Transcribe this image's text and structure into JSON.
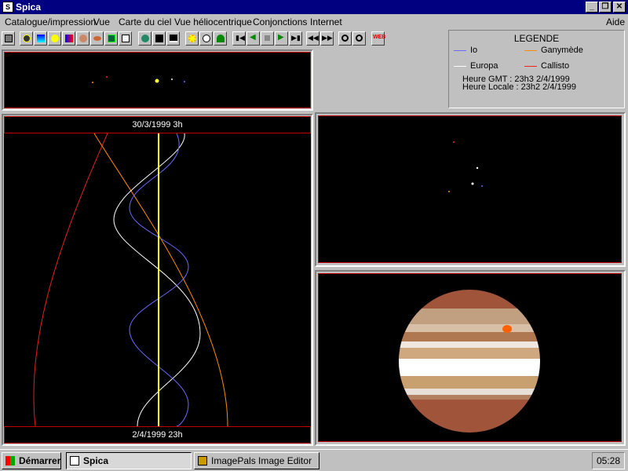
{
  "window": {
    "title": "Spica",
    "app_icon": "spica-icon"
  },
  "menu": {
    "items": [
      "Catalogue/impression",
      "Vue",
      "Carte du ciel",
      "Vue héliocentrique",
      "Conjonctions",
      "Internet"
    ],
    "help": "Aide"
  },
  "toolbar": {
    "buttons": [
      "print-icon",
      "globe-icon",
      "spectrum-icon",
      "star-icon",
      "color-map-icon",
      "planet-icon",
      "saturn-icon",
      "radar-icon",
      "document-icon",
      "earth-icon",
      "starfield-icon",
      "wave-icon",
      "sun-icon",
      "moon-icon",
      "tree-icon",
      "skip-back-icon",
      "step-back-icon",
      "stop-icon",
      "play-icon",
      "skip-forward-icon",
      "rewind-icon",
      "fast-forward-icon",
      "zoom-in-icon",
      "zoom-out-icon",
      "web-icon"
    ],
    "web_label": "WEB"
  },
  "legend": {
    "title": "LEGENDE",
    "entries": [
      {
        "name": "Io",
        "color": "#6a6aff"
      },
      {
        "name": "Ganymède",
        "color": "#ff8c00"
      },
      {
        "name": "Europa",
        "color": "#ffffff"
      },
      {
        "name": "Callisto",
        "color": "#ff2020"
      }
    ],
    "gmt": "Heure GMT : 23h3 2/4/1999",
    "local": "Heure Locale : 23h2 2/4/1999"
  },
  "chart_panel": {
    "start_date": "30/3/1999 3h",
    "end_date": "2/4/1999 23h"
  },
  "taskbar": {
    "start": "Démarrer",
    "tasks": [
      "Spica",
      "ImagePals Image Editor"
    ],
    "clock": "05:28"
  }
}
